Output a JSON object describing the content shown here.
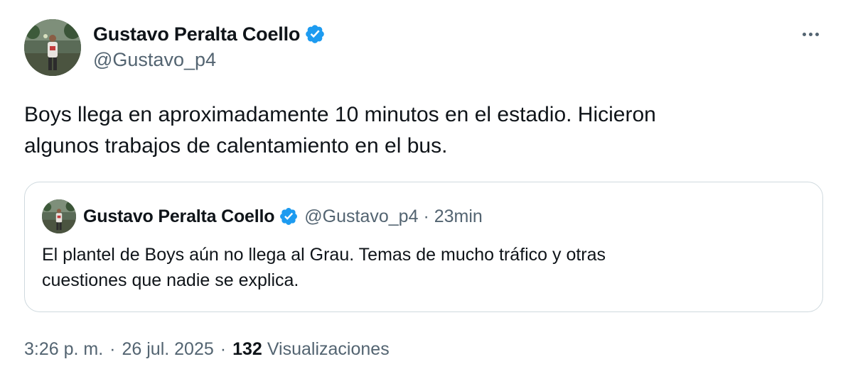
{
  "author": {
    "display_name": "Gustavo Peralta Coello",
    "handle": "@Gustavo_p4",
    "verified": true
  },
  "tweet": {
    "line1": "Boys llega en aproximadamente 10 minutos en el estadio. Hicieron",
    "line2": "algunos trabajos de calentamiento en el bus."
  },
  "quoted_tweet": {
    "display_name": "Gustavo Peralta Coello",
    "handle": "@Gustavo_p4",
    "separator": "·",
    "time": "23min",
    "line1": "El plantel de Boys aún no llega al Grau. Temas de mucho tráfico y otras",
    "line2": "cuestiones que nadie se explica."
  },
  "footer": {
    "time": "3:26 p. m.",
    "separator": "·",
    "date": "26 jul. 2025",
    "separator2": "·",
    "views_count": "132",
    "views_label": "Visualizaciones"
  },
  "colors": {
    "verified_badge": "#1d9bf0",
    "secondary_text": "#536471",
    "border": "#cfd9de"
  },
  "icons": {
    "verified": "verified-badge-icon",
    "more": "more-options-icon"
  }
}
